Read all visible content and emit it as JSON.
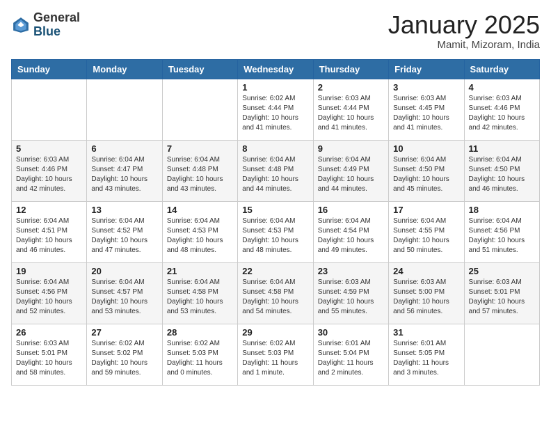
{
  "logo": {
    "general": "General",
    "blue": "Blue"
  },
  "header": {
    "month": "January 2025",
    "location": "Mamit, Mizoram, India"
  },
  "days_of_week": [
    "Sunday",
    "Monday",
    "Tuesday",
    "Wednesday",
    "Thursday",
    "Friday",
    "Saturday"
  ],
  "weeks": [
    [
      {
        "day": "",
        "info": ""
      },
      {
        "day": "",
        "info": ""
      },
      {
        "day": "",
        "info": ""
      },
      {
        "day": "1",
        "info": "Sunrise: 6:02 AM\nSunset: 4:44 PM\nDaylight: 10 hours\nand 41 minutes."
      },
      {
        "day": "2",
        "info": "Sunrise: 6:03 AM\nSunset: 4:44 PM\nDaylight: 10 hours\nand 41 minutes."
      },
      {
        "day": "3",
        "info": "Sunrise: 6:03 AM\nSunset: 4:45 PM\nDaylight: 10 hours\nand 41 minutes."
      },
      {
        "day": "4",
        "info": "Sunrise: 6:03 AM\nSunset: 4:46 PM\nDaylight: 10 hours\nand 42 minutes."
      }
    ],
    [
      {
        "day": "5",
        "info": "Sunrise: 6:03 AM\nSunset: 4:46 PM\nDaylight: 10 hours\nand 42 minutes."
      },
      {
        "day": "6",
        "info": "Sunrise: 6:04 AM\nSunset: 4:47 PM\nDaylight: 10 hours\nand 43 minutes."
      },
      {
        "day": "7",
        "info": "Sunrise: 6:04 AM\nSunset: 4:48 PM\nDaylight: 10 hours\nand 43 minutes."
      },
      {
        "day": "8",
        "info": "Sunrise: 6:04 AM\nSunset: 4:48 PM\nDaylight: 10 hours\nand 44 minutes."
      },
      {
        "day": "9",
        "info": "Sunrise: 6:04 AM\nSunset: 4:49 PM\nDaylight: 10 hours\nand 44 minutes."
      },
      {
        "day": "10",
        "info": "Sunrise: 6:04 AM\nSunset: 4:50 PM\nDaylight: 10 hours\nand 45 minutes."
      },
      {
        "day": "11",
        "info": "Sunrise: 6:04 AM\nSunset: 4:50 PM\nDaylight: 10 hours\nand 46 minutes."
      }
    ],
    [
      {
        "day": "12",
        "info": "Sunrise: 6:04 AM\nSunset: 4:51 PM\nDaylight: 10 hours\nand 46 minutes."
      },
      {
        "day": "13",
        "info": "Sunrise: 6:04 AM\nSunset: 4:52 PM\nDaylight: 10 hours\nand 47 minutes."
      },
      {
        "day": "14",
        "info": "Sunrise: 6:04 AM\nSunset: 4:53 PM\nDaylight: 10 hours\nand 48 minutes."
      },
      {
        "day": "15",
        "info": "Sunrise: 6:04 AM\nSunset: 4:53 PM\nDaylight: 10 hours\nand 48 minutes."
      },
      {
        "day": "16",
        "info": "Sunrise: 6:04 AM\nSunset: 4:54 PM\nDaylight: 10 hours\nand 49 minutes."
      },
      {
        "day": "17",
        "info": "Sunrise: 6:04 AM\nSunset: 4:55 PM\nDaylight: 10 hours\nand 50 minutes."
      },
      {
        "day": "18",
        "info": "Sunrise: 6:04 AM\nSunset: 4:56 PM\nDaylight: 10 hours\nand 51 minutes."
      }
    ],
    [
      {
        "day": "19",
        "info": "Sunrise: 6:04 AM\nSunset: 4:56 PM\nDaylight: 10 hours\nand 52 minutes."
      },
      {
        "day": "20",
        "info": "Sunrise: 6:04 AM\nSunset: 4:57 PM\nDaylight: 10 hours\nand 53 minutes."
      },
      {
        "day": "21",
        "info": "Sunrise: 6:04 AM\nSunset: 4:58 PM\nDaylight: 10 hours\nand 53 minutes."
      },
      {
        "day": "22",
        "info": "Sunrise: 6:04 AM\nSunset: 4:58 PM\nDaylight: 10 hours\nand 54 minutes."
      },
      {
        "day": "23",
        "info": "Sunrise: 6:03 AM\nSunset: 4:59 PM\nDaylight: 10 hours\nand 55 minutes."
      },
      {
        "day": "24",
        "info": "Sunrise: 6:03 AM\nSunset: 5:00 PM\nDaylight: 10 hours\nand 56 minutes."
      },
      {
        "day": "25",
        "info": "Sunrise: 6:03 AM\nSunset: 5:01 PM\nDaylight: 10 hours\nand 57 minutes."
      }
    ],
    [
      {
        "day": "26",
        "info": "Sunrise: 6:03 AM\nSunset: 5:01 PM\nDaylight: 10 hours\nand 58 minutes."
      },
      {
        "day": "27",
        "info": "Sunrise: 6:02 AM\nSunset: 5:02 PM\nDaylight: 10 hours\nand 59 minutes."
      },
      {
        "day": "28",
        "info": "Sunrise: 6:02 AM\nSunset: 5:03 PM\nDaylight: 11 hours\nand 0 minutes."
      },
      {
        "day": "29",
        "info": "Sunrise: 6:02 AM\nSunset: 5:03 PM\nDaylight: 11 hours\nand 1 minute."
      },
      {
        "day": "30",
        "info": "Sunrise: 6:01 AM\nSunset: 5:04 PM\nDaylight: 11 hours\nand 2 minutes."
      },
      {
        "day": "31",
        "info": "Sunrise: 6:01 AM\nSunset: 5:05 PM\nDaylight: 11 hours\nand 3 minutes."
      },
      {
        "day": "",
        "info": ""
      }
    ]
  ]
}
